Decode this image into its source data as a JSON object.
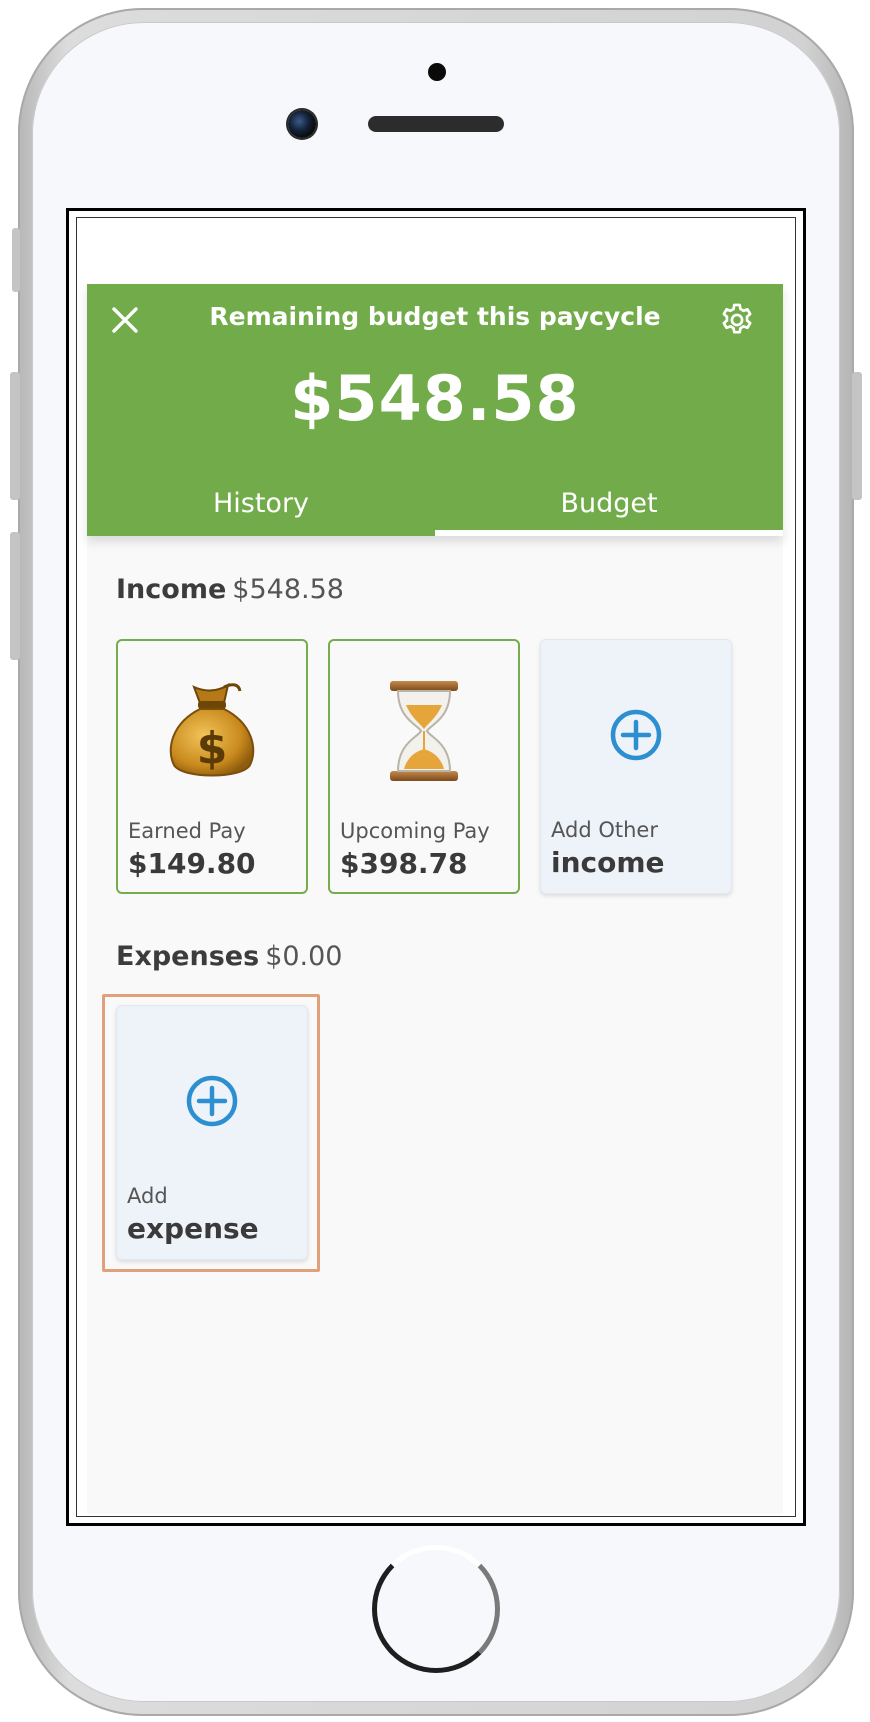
{
  "header": {
    "title": "Remaining budget this paycycle",
    "amount": "$548.58",
    "close_icon": "close-icon",
    "settings_icon": "gear-icon"
  },
  "tabs": [
    {
      "label": "History",
      "active": false
    },
    {
      "label": "Budget",
      "active": true
    }
  ],
  "income": {
    "label": "Income",
    "amount": "$548.58",
    "cards": [
      {
        "icon": "money-bag-icon",
        "label": "Earned Pay",
        "value": "$149.80"
      },
      {
        "icon": "hourglass-icon",
        "label": "Upcoming Pay",
        "value": "$398.78"
      },
      {
        "icon": "add-circle-icon",
        "label": "Add Other",
        "value": "income"
      }
    ]
  },
  "expenses": {
    "label": "Expenses",
    "amount": "$0.00",
    "cards": [
      {
        "icon": "add-circle-icon",
        "label": "Add",
        "value": "expense"
      }
    ]
  },
  "colors": {
    "header_green": "#72ab4a",
    "card_border_green": "#74ac4e",
    "add_blue": "#2e8fd0",
    "highlight_orange": "#e0a07a"
  }
}
